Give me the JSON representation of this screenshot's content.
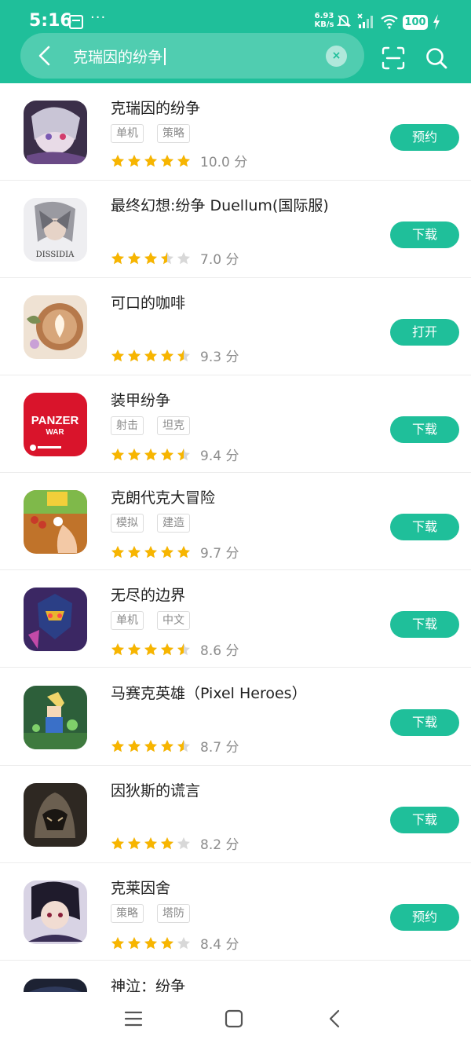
{
  "status_bar": {
    "time": "5:16",
    "more": "···",
    "net_speed": "6.93",
    "net_unit": "KB/s",
    "battery": "100",
    "icons": [
      "calendar-card-icon",
      "mute-icon",
      "signal-off-icon",
      "wifi-icon",
      "battery-icon",
      "charging-icon"
    ]
  },
  "search": {
    "query": "克瑞因的纷争",
    "clear_icon": "×",
    "icons": [
      "back-icon",
      "scan-icon",
      "search-icon"
    ]
  },
  "apps": [
    {
      "name": "克瑞因的纷争",
      "tags": [
        "单机",
        "策略"
      ],
      "stars": 5,
      "score": "10.0 分",
      "action": "预约",
      "icon_color": "#5b4a6e"
    },
    {
      "name": "最终幻想:纷争 Duellum(国际服)",
      "tags": [],
      "stars": 3.5,
      "score": "7.0 分",
      "action": "下载",
      "icon_color": "#d9dadf"
    },
    {
      "name": "可口的咖啡",
      "tags": [],
      "stars": 4.5,
      "score": "9.3 分",
      "action": "打开",
      "icon_color": "#c69a6d"
    },
    {
      "name": "装甲纷争",
      "tags": [
        "射击",
        "坦克"
      ],
      "stars": 4.5,
      "score": "9.4 分",
      "action": "下载",
      "icon_color": "#d9142b"
    },
    {
      "name": "克朗代克大冒险",
      "tags": [
        "模拟",
        "建造"
      ],
      "stars": 5,
      "score": "9.7 分",
      "action": "下载",
      "icon_color": "#c77b2c"
    },
    {
      "name": "无尽的边界",
      "tags": [
        "单机",
        "中文"
      ],
      "stars": 4.5,
      "score": "8.6 分",
      "action": "下载",
      "icon_color": "#3f2a6b"
    },
    {
      "name": "马赛克英雄（Pixel Heroes）",
      "tags": [],
      "stars": 4.5,
      "score": "8.7 分",
      "action": "下载",
      "icon_color": "#2f6a3c"
    },
    {
      "name": "因狄斯的谎言",
      "tags": [],
      "stars": 4,
      "score": "8.2 分",
      "action": "下载",
      "icon_color": "#4c4236"
    },
    {
      "name": "克莱因舍",
      "tags": [
        "策略",
        "塔防"
      ],
      "stars": 4,
      "score": "8.4 分",
      "action": "预约",
      "icon_color": "#2a2540"
    },
    {
      "name": "神泣：纷争",
      "tags": [],
      "stars": 0,
      "score": "",
      "action": "",
      "icon_color": "#1d2233"
    }
  ],
  "icon_text": {
    "panzer": "PANZER",
    "panzer_sub": "WAR",
    "dissidia": "DISSIDIA"
  },
  "colors": {
    "accent": "#1fbf9a",
    "star": "#f7b500",
    "star_empty": "#d8d8d8"
  },
  "nav": [
    "menu-icon",
    "home-icon",
    "back-nav-icon"
  ]
}
